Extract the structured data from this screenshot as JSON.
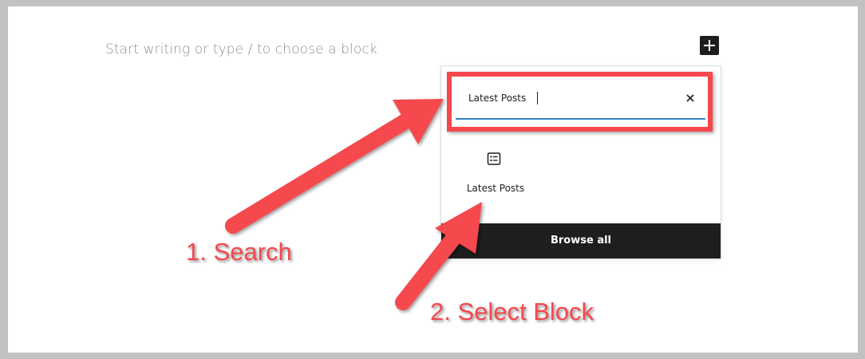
{
  "editor": {
    "placeholder": "Start writing or type / to choose a block",
    "add_block_icon": "plus-icon"
  },
  "inserter": {
    "search": {
      "value": "Latest Posts",
      "clear_icon": "close-icon"
    },
    "results": [
      {
        "label": "Latest Posts",
        "icon": "post-list-icon"
      }
    ],
    "browse_all_label": "Browse all"
  },
  "annotations": {
    "step1": "1. Search",
    "step2": "2. Select Block",
    "color": "#f5484d"
  },
  "colors": {
    "page_border": "#c2c2c2",
    "dark": "#1e1e1e",
    "focus_underline": "#3582c4",
    "highlight": "#f5484d"
  }
}
